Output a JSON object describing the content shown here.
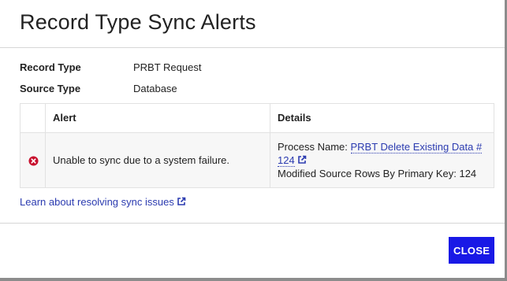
{
  "dialog": {
    "title": "Record Type Sync Alerts"
  },
  "meta": {
    "record_type_label": "Record Type",
    "record_type_value": "PRBT Request",
    "source_type_label": "Source Type",
    "source_type_value": "Database"
  },
  "table": {
    "headers": [
      "",
      "Alert",
      "Details"
    ],
    "rows": [
      {
        "status_icon": "error-circle-icon",
        "alert": "Unable to sync due to a system failure.",
        "details": {
          "process_prefix": "Process Name:",
          "process_link_line1": "PRBT Delete Existing Data #",
          "process_link_line2": "124",
          "modified_rows": "Modified Source Rows By Primary Key: 124"
        }
      }
    ]
  },
  "links": {
    "learn": "Learn about resolving sync issues"
  },
  "footer": {
    "close_label": "CLOSE"
  },
  "colors": {
    "accent": "#1919e6",
    "link": "#2b3bb0",
    "error": "#c8102e"
  }
}
